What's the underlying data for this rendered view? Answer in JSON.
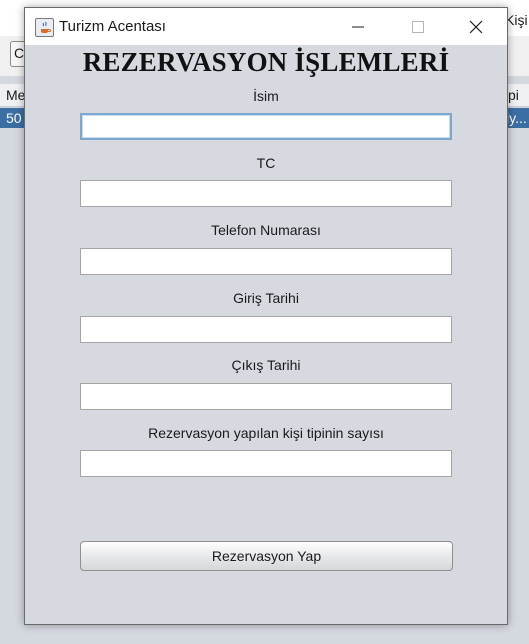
{
  "background_app": {
    "top_right_text": "Kişi",
    "header_left": "Me",
    "header_right": "pi",
    "row_left": "50",
    "row_right": "iy...",
    "combo_text": "C"
  },
  "window": {
    "title": "Turizm Acentası",
    "icon": "java-app-icon",
    "controls": [
      "minimize-icon",
      "maximize-icon",
      "close-icon"
    ]
  },
  "form": {
    "heading": "REZERVASYON İŞLEMLERİ",
    "fields": [
      {
        "label": "İsim",
        "value": ""
      },
      {
        "label": "TC",
        "value": ""
      },
      {
        "label": "Telefon Numarası",
        "value": ""
      },
      {
        "label": "Giriş Tarihi",
        "value": ""
      },
      {
        "label": "Çıkış Tarihi",
        "value": ""
      },
      {
        "label": "Rezervasyon yapılan kişi tipinin sayısı",
        "value": ""
      }
    ],
    "submit_label": "Rezervasyon Yap"
  },
  "colors": {
    "dialog_bg": "#d6d9e0",
    "selection_row": "#3b6ea3",
    "focus_border": "#7ea7cf"
  }
}
